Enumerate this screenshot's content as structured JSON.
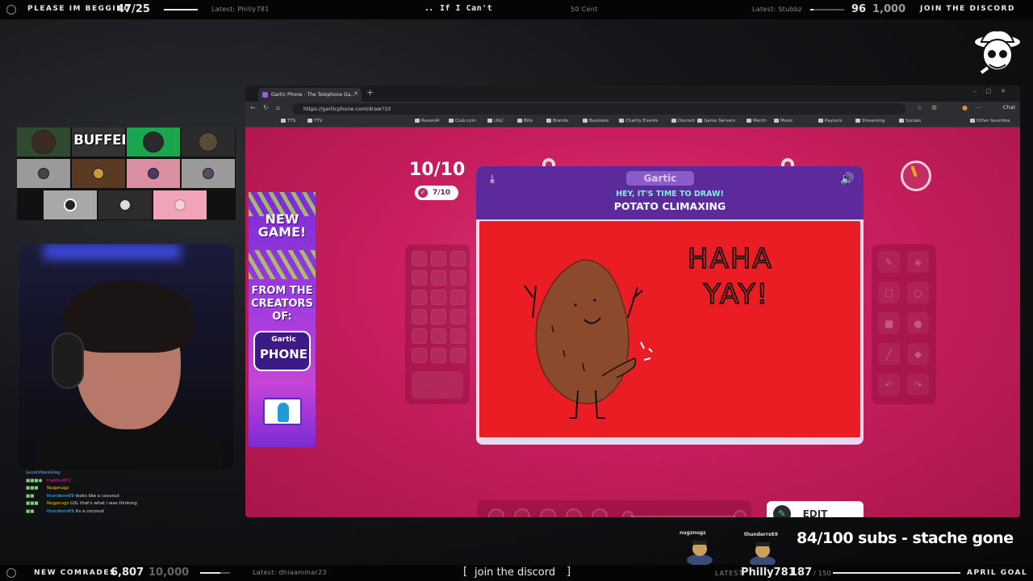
{
  "overlay_top": {
    "label_left": "PLEASE IM BEGGING",
    "count_left": "47/25",
    "latest_left": "Latest: Philly781",
    "now_playing": "If I Can't",
    "artist": "50 Cent",
    "latest_right": "Latest: Stubbz",
    "count_right_current": "96",
    "count_right_goal": "1,000",
    "discord_cta": "JOIN THE DISCORD"
  },
  "overlay_bottom": {
    "comrades_label": "NEW COMRADES",
    "comrades_current": "6,807",
    "comrades_goal": "10,000",
    "latest_left": "Latest: dhiaammar23",
    "discord_text": "join the discord",
    "latest_label": "LATEST",
    "latest_name": "Philly781",
    "goal_current": "187",
    "goal_total": "/ 150",
    "goal_label": "APRIL GOAL"
  },
  "webcam_grid": {
    "overlay_text": "BUFFED"
  },
  "chat": {
    "header": "GoodVibesGreg",
    "messages": [
      {
        "user": "Hatifav802",
        "text": ""
      },
      {
        "user": "Nugznugz",
        "text": ""
      },
      {
        "user": "thunderrs69",
        "text": "looks like a coconut"
      },
      {
        "user": "Nugznugz",
        "text": "LOL that's what i was thinking"
      },
      {
        "user": "thunderrs69",
        "text": "its a coconut"
      }
    ]
  },
  "browser": {
    "tab_title": "Gartic Phone - The Telephone Ga...",
    "url": "https://garticphone.com/draw?10",
    "chat_button": "Chat",
    "bookmarks": [
      "TTS",
      "TTV",
      "RavenAI",
      "Club.com",
      "UGC",
      "Bills",
      "Brands",
      "Business",
      "Charity Events",
      "Discord",
      "Game Servers",
      "Merch",
      "Music",
      "Payouts",
      "Streaming",
      "Socials"
    ],
    "other_favorites": "Other favorites"
  },
  "game": {
    "round": "10/10",
    "done_count": "7/10",
    "brand": "Gartic",
    "prompt_line1": "HEY, IT'S TIME TO DRAW!",
    "prompt_line2": "POTATO CLIMAXING",
    "drawing_text_1": "HAHA",
    "drawing_text_2": "YAY!",
    "edit_label": "EDIT",
    "timer_fraction": 0.05
  },
  "ad": {
    "line1": "NEW",
    "line2": "GAME!",
    "line3": "FROM THE",
    "line4": "CREATORS",
    "line5": "OF:",
    "logo_top": "Gartic",
    "logo_bottom": "PHONE"
  },
  "alerts": {
    "user1": "nugznugz",
    "user2": "thunderrs69",
    "subs_goal": "84/100 subs - stache gone"
  },
  "colors": {
    "game_bg": "#c81e5f",
    "card_header": "#5c2a9a",
    "canvas": "#ea1c24",
    "potato": "#8b4a2b",
    "prompt_accent": "#7ff0e6"
  }
}
